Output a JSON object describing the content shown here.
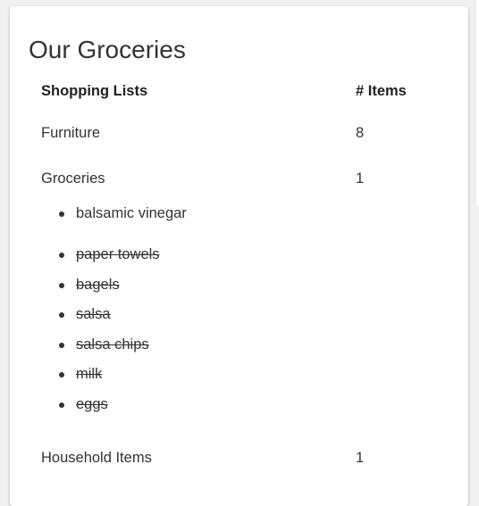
{
  "card": {
    "title": "Our Groceries"
  },
  "table": {
    "headers": {
      "name": "Shopping Lists",
      "count": "# Items"
    },
    "rows": [
      {
        "name": "Furniture",
        "count": "8"
      },
      {
        "name": "Groceries",
        "count": "1"
      },
      {
        "name": "Household Items",
        "count": "1"
      }
    ]
  },
  "groceries": {
    "active_items": [
      "balsamic vinegar"
    ],
    "crossed_items": [
      "paper towels",
      "bagels",
      "salsa",
      "salsa chips",
      "milk",
      "eggs"
    ]
  }
}
